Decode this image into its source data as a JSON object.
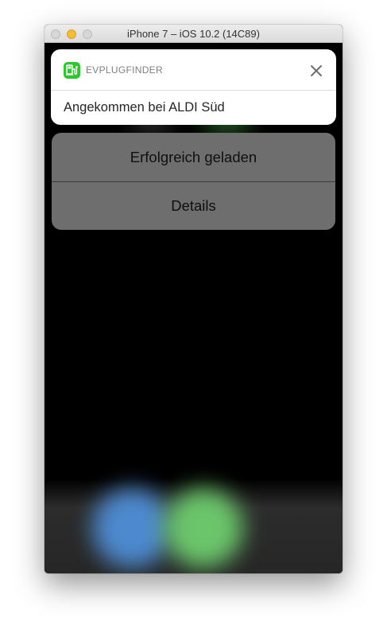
{
  "window": {
    "title": "iPhone 7 – iOS 10.2 (14C89)"
  },
  "notification": {
    "app_name": "EVPLUGFINDER",
    "message": "Angekommen bei ALDI Süd",
    "app_icon": "ev-plug-icon",
    "close_icon": "close-icon"
  },
  "actions": [
    {
      "label": "Erfolgreich geladen"
    },
    {
      "label": "Details"
    }
  ],
  "colors": {
    "app_icon": "#2fc72f",
    "action_sheet": "#6e6e6e",
    "minimize_button": "#f5bd35"
  }
}
